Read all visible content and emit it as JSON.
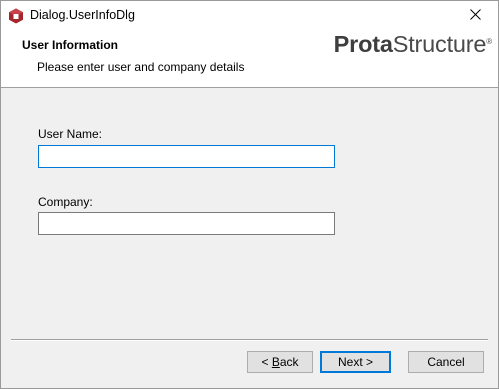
{
  "window": {
    "title": "Dialog.UserInfoDlg"
  },
  "header": {
    "title": "User Information",
    "subtitle": "Please enter user and company details",
    "logo": {
      "bold_part": "Prota",
      "normal_part": "Structure",
      "mark": "®"
    }
  },
  "form": {
    "user_name": {
      "label": "User Name:",
      "value": ""
    },
    "company": {
      "label": "Company:",
      "value": ""
    }
  },
  "buttons": {
    "back": {
      "prefix": "< ",
      "mnemonic": "B",
      "rest": "ack"
    },
    "next": {
      "label": "Next >"
    },
    "cancel": {
      "label": "Cancel"
    }
  },
  "colors": {
    "accent": "#0078d7",
    "app_icon": "#a4262c"
  }
}
